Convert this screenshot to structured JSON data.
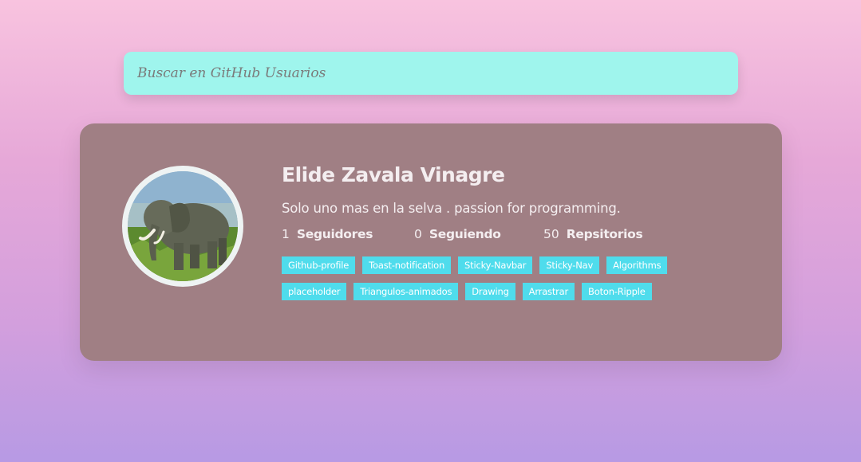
{
  "search": {
    "placeholder": "Buscar en GitHub Usuarios"
  },
  "profile": {
    "name": "Elide Zavala Vinagre",
    "bio": "Solo uno mas en la selva . passion for programming.",
    "avatar_alt": "elephant",
    "stats": [
      {
        "value": "1",
        "label": "Seguidores"
      },
      {
        "value": "0",
        "label": "Seguiendo"
      },
      {
        "value": "50",
        "label": "Repsitorios"
      }
    ],
    "repos": [
      "Github-profile",
      "Toast-notification",
      "Sticky-Navbar",
      "Sticky-Nav",
      "Algorithms",
      "placeholder",
      "Triangulos-animados",
      "Drawing",
      "Arrastrar",
      "Boton-Ripple"
    ]
  },
  "colors": {
    "search_bg": "#9ff5ed",
    "card_bg": "#a07f84",
    "tag_bg": "#4fdcec",
    "text": "#f4eef0"
  }
}
